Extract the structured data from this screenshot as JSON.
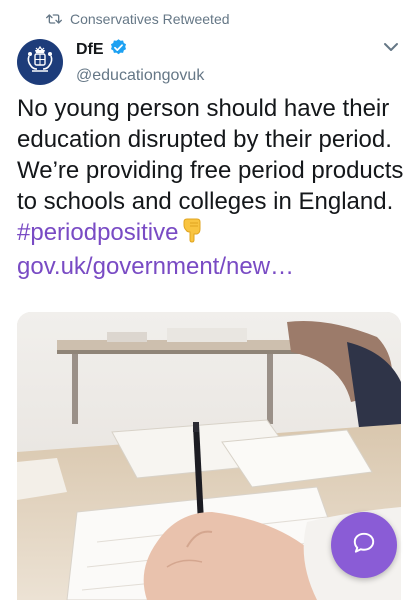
{
  "retweet": {
    "icon": "retweet-icon",
    "text": "Conservatives Retweeted"
  },
  "author": {
    "display_name": "DfE",
    "verified": true,
    "handle": "@educationgovuk",
    "avatar_icon": "royal-crest-icon"
  },
  "tweet": {
    "text_plain": "No young person should have their education disrupted by their period. We’re providing free period products to schools and colleges in England.",
    "hashtag": "#periodpositive",
    "emoji": "backhand-index-pointing-down",
    "link": "gov.uk/government/new…"
  },
  "media": {
    "kind": "photo"
  },
  "fab": {
    "icon": "compose-reply-icon"
  },
  "colors": {
    "accent": "#794bc4",
    "fab": "#8a5cd6",
    "verified": "#1da1f2",
    "secondary_text": "#657786"
  }
}
